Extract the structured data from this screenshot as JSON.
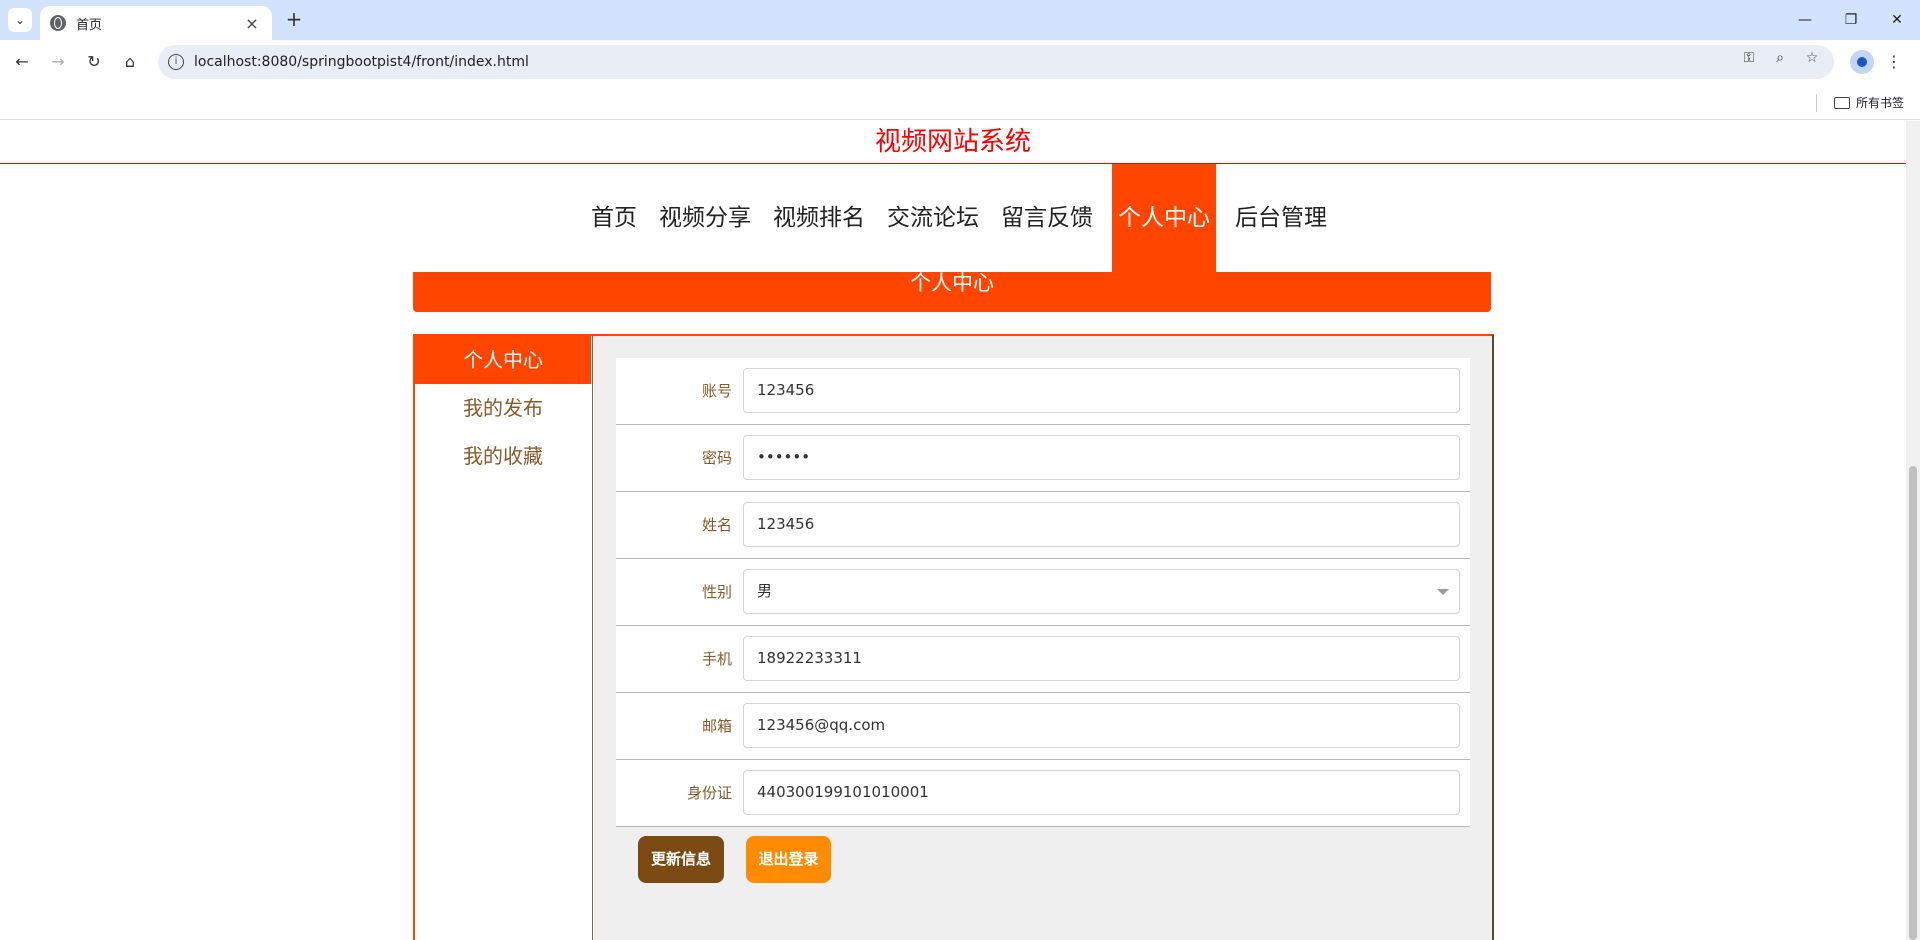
{
  "browser": {
    "tab_title": "首页",
    "url": "localhost:8080/springbootpist4/front/index.html",
    "bookmarks_label": "所有书签"
  },
  "site": {
    "title": "视频网站系统",
    "nav": [
      "首页",
      "视频分享",
      "视频排名",
      "交流论坛",
      "留言反馈",
      "个人中心",
      "后台管理"
    ],
    "active_nav": "个人中心",
    "banner": "个人中心"
  },
  "sidebar": {
    "items": [
      "个人中心",
      "我的发布",
      "我的收藏"
    ]
  },
  "form": {
    "fields": [
      {
        "label": "账号",
        "value": "123456"
      },
      {
        "label": "密码",
        "value": "••••••"
      },
      {
        "label": "姓名",
        "value": "123456"
      },
      {
        "label": "性别",
        "value": "男"
      },
      {
        "label": "手机",
        "value": "18922233311"
      },
      {
        "label": "邮箱",
        "value": "123456@qq.com"
      },
      {
        "label": "身份证",
        "value": "440300199101010001"
      }
    ],
    "update_label": "更新信息",
    "logout_label": "退出登录"
  }
}
